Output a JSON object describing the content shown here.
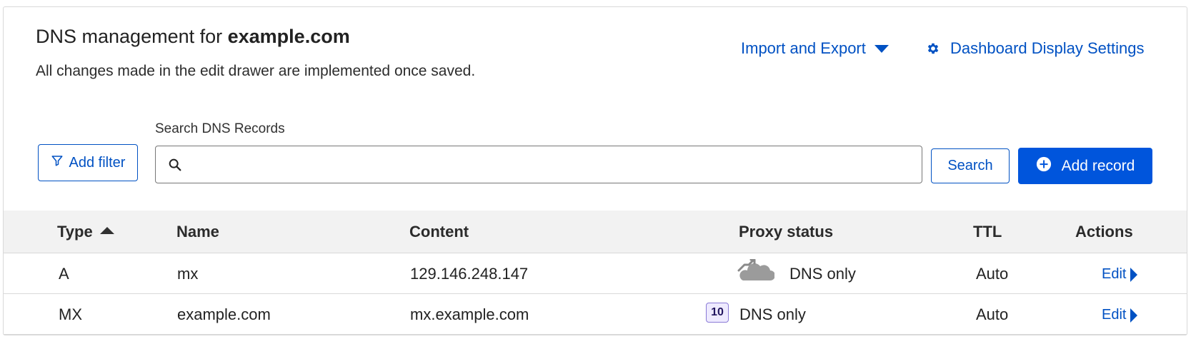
{
  "header": {
    "title_prefix": "DNS management for ",
    "domain": "example.com",
    "subtitle": "All changes made in the edit drawer are implemented once saved.",
    "import_export_label": "Import and Export",
    "settings_label": "Dashboard Display Settings"
  },
  "search": {
    "label": "Search DNS Records",
    "value": "",
    "placeholder": "",
    "button_label": "Search"
  },
  "toolbar": {
    "add_filter_label": "Add filter",
    "add_record_label": "Add record"
  },
  "table": {
    "columns": [
      "Type",
      "Name",
      "Content",
      "Proxy status",
      "TTL",
      "Actions"
    ],
    "sorted_column": "Type",
    "sort_direction": "ascending",
    "rows": [
      {
        "type": "A",
        "name": "mx",
        "content": "129.146.248.147",
        "priority": "",
        "proxy_status": "DNS only",
        "ttl": "Auto",
        "action": "Edit"
      },
      {
        "type": "MX",
        "name": "example.com",
        "content": "mx.example.com",
        "priority": "10",
        "proxy_status": "DNS only",
        "ttl": "Auto",
        "action": "Edit"
      }
    ]
  },
  "colors": {
    "accent": "#0051c3",
    "primary_button": "#0055dc",
    "header_bg": "#f2f2f2",
    "priority_badge_bg": "#eeeaff"
  },
  "icons": {
    "import_export": "chevron-down-icon",
    "settings": "gear-icon",
    "add_filter": "filter-icon",
    "search": "search-icon",
    "add_record": "plus-circle-icon",
    "sort": "sort-ascending-icon",
    "proxy_dns_only": "cloud-dns-only-icon",
    "edit": "chevron-right-icon"
  }
}
